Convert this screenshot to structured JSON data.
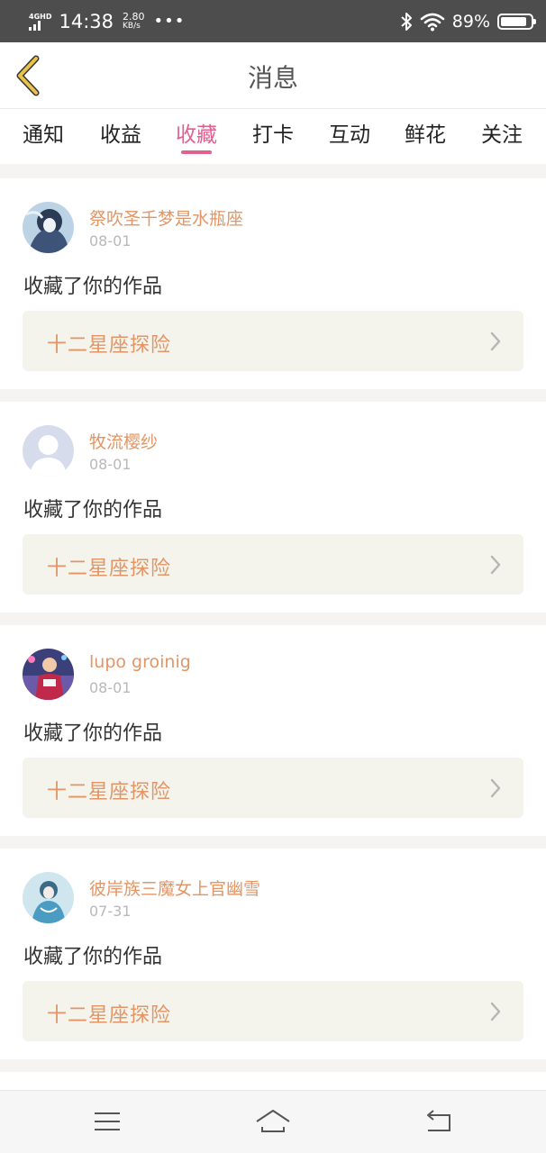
{
  "status_bar": {
    "network": "4GHD",
    "time": "14:38",
    "speed_value": "2.80",
    "speed_unit": "KB/s",
    "more": "•••",
    "battery_percent": "89%",
    "battery_level": 0.89
  },
  "header": {
    "title": "消息",
    "back_icon": "chevron-left-icon",
    "back_color": "#e8c24a"
  },
  "tabs": [
    {
      "label": "通知",
      "active": false
    },
    {
      "label": "收益",
      "active": false
    },
    {
      "label": "收藏",
      "active": true
    },
    {
      "label": "打卡",
      "active": false
    },
    {
      "label": "互动",
      "active": false
    },
    {
      "label": "鲜花",
      "active": false
    },
    {
      "label": "关注",
      "active": false
    }
  ],
  "messages": [
    {
      "username": "祭吹圣千梦是水瓶座",
      "date": "08-01",
      "text": "收藏了你的作品",
      "work_title": "十二星座探险"
    },
    {
      "username": "牧流樱纱",
      "date": "08-01",
      "text": "收藏了你的作品",
      "work_title": "十二星座探险"
    },
    {
      "username": "lupo groinig",
      "date": "08-01",
      "text": "收藏了你的作品",
      "work_title": "十二星座探险"
    },
    {
      "username": "彼岸族三魔女上官幽雪",
      "date": "07-31",
      "text": "收藏了你的作品",
      "work_title": "十二星座探险"
    }
  ],
  "colors": {
    "accent_pink": "#e0608f",
    "orange_text": "#e29565",
    "work_bg": "#f4f3ec"
  },
  "nav_bar": {
    "menu_icon": "menu-icon",
    "home_icon": "home-icon",
    "back_icon": "back-icon"
  }
}
